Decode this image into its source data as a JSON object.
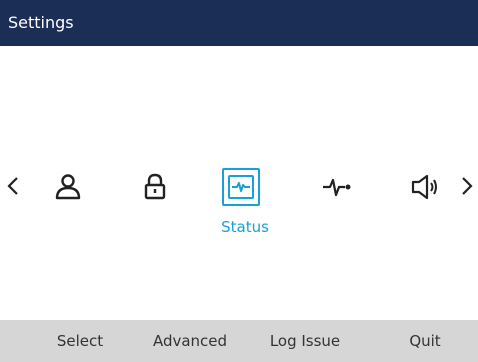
{
  "header": {
    "title": "Settings"
  },
  "carousel": {
    "items": [
      {
        "icon": "user-icon"
      },
      {
        "icon": "lock-icon"
      },
      {
        "icon": "status-icon",
        "selected": true
      },
      {
        "icon": "pulse-icon"
      },
      {
        "icon": "speaker-icon"
      }
    ],
    "selected_label": "Status"
  },
  "softkeys": [
    "Select",
    "Advanced",
    "Log Issue",
    "Quit"
  ],
  "colors": {
    "header_bg": "#1b2e55",
    "accent": "#1aa0d8",
    "softkey_bg": "#d6d6d6"
  }
}
